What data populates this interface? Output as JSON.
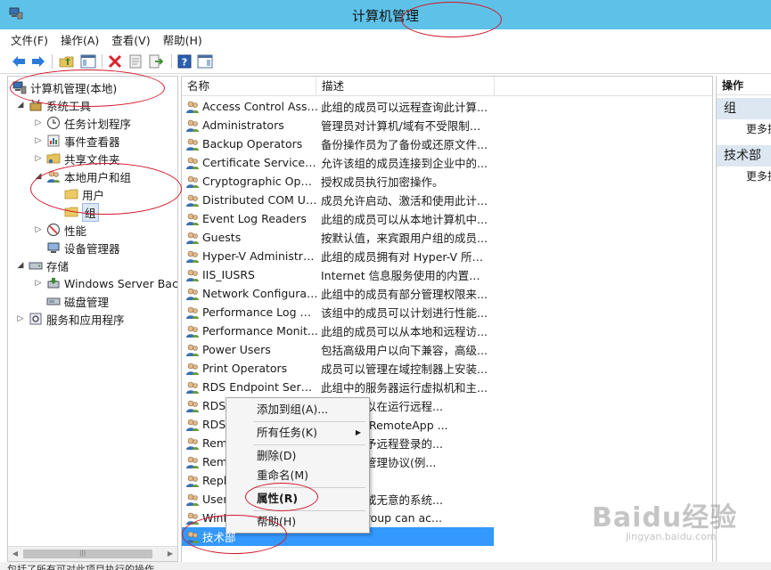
{
  "window": {
    "title": "计算机管理"
  },
  "menubar": [
    {
      "label": "文件(F)"
    },
    {
      "label": "操作(A)"
    },
    {
      "label": "查看(V)"
    },
    {
      "label": "帮助(H)"
    }
  ],
  "toolbar": {
    "icons": [
      "back-arrow-icon",
      "forward-arrow-icon",
      "up-folder-icon",
      "show-tree-icon",
      "delete-icon",
      "properties-icon",
      "export-icon",
      "help-icon",
      "show-action-pane-icon"
    ]
  },
  "tree": {
    "root": "计算机管理(本地)",
    "system_tools": "系统工具",
    "task_scheduler": "任务计划程序",
    "event_viewer": "事件查看器",
    "shared_folders": "共享文件夹",
    "local_users_groups": "本地用户和组",
    "users": "用户",
    "groups": "组",
    "performance": "性能",
    "device_manager": "设备管理器",
    "storage": "存储",
    "windows_server_backup": "Windows Server Back",
    "disk_management": "磁盘管理",
    "services_apps": "服务和应用程序"
  },
  "list": {
    "col_name": "名称",
    "col_desc": "描述",
    "rows": [
      {
        "name": "Access Control Assi...",
        "desc": "此组的成员可以远程查询此计算..."
      },
      {
        "name": "Administrators",
        "desc": "管理员对计算机/域有不受限制的..."
      },
      {
        "name": "Backup Operators",
        "desc": "备份操作员为了备份或还原文件..."
      },
      {
        "name": "Certificate Service D...",
        "desc": "允许该组的成员连接到企业中的..."
      },
      {
        "name": "Cryptographic Oper...",
        "desc": "授权成员执行加密操作。"
      },
      {
        "name": "Distributed COM Us...",
        "desc": "成员允许启动、激活和使用此计..."
      },
      {
        "name": "Event Log Readers",
        "desc": "此组的成员可以从本地计算机中..."
      },
      {
        "name": "Guests",
        "desc": "按默认值，来宾跟用户组的成员..."
      },
      {
        "name": "Hyper-V Administra...",
        "desc": "此组的成员拥有对 Hyper-V 所有..."
      },
      {
        "name": "IIS_IUSRS",
        "desc": "Internet 信息服务使用的内置组。"
      },
      {
        "name": "Network Configurat...",
        "desc": "此组中的成员有部分管理权限来..."
      },
      {
        "name": "Performance Log U...",
        "desc": "该组中的成员可以计划进行性能..."
      },
      {
        "name": "Performance Monit...",
        "desc": "此组的成员可以从本地和远程访..."
      },
      {
        "name": "Power Users",
        "desc": "包括高级用户以向下兼容，高级..."
      },
      {
        "name": "Print Operators",
        "desc": "成员可以管理在域控制器上安装..."
      },
      {
        "name": "RDS Endpoint Serve...",
        "desc": "此组中的服务器运行虚拟机和主..."
      },
      {
        "name": "RDS",
        "desc": "服务器可以在运行远程..."
      },
      {
        "name": "RDS",
        "desc": "服务器使 RemoteApp ..."
      },
      {
        "name": "Remo",
        "desc": "成员被授予远程登录的..."
      },
      {
        "name": "Remo",
        "desc": "可以通过管理协议(例..."
      },
      {
        "name": "Repl",
        "desc": "文件复制"
      },
      {
        "name": "User",
        "desc": "进行有意或无意的系统..."
      },
      {
        "name": "WinR",
        "desc": "of this group can ac..."
      },
      {
        "name": "技术部",
        "desc": ""
      }
    ]
  },
  "context_menu": {
    "add_to_group": "添加到组(A)...",
    "all_tasks": "所有任务(K)",
    "delete": "删除(D)",
    "rename": "重命名(M)",
    "properties": "属性(R)",
    "help": "帮助(H)"
  },
  "actions": {
    "header": "操作",
    "section1": "组",
    "more1": "更多操",
    "section2": "技术部",
    "more2": "更多操"
  },
  "statusbar": {
    "text": "包括了所有可对此项目执行的操作。"
  },
  "watermark": {
    "logo": "Baidu经验",
    "sub": "jingyan.baidu.com"
  },
  "colors": {
    "titlebar": "#5ec2e8",
    "selection": "#3399ff",
    "annotation": "#d0182c"
  }
}
